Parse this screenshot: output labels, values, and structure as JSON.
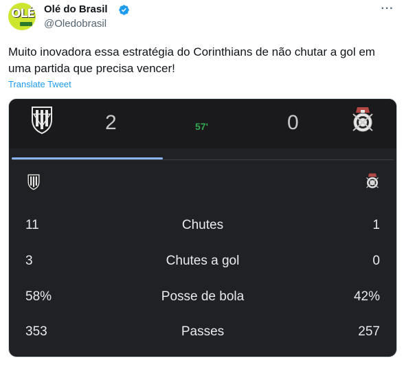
{
  "tweet": {
    "display_name": "Olé do Brasil",
    "handle": "@Oledobrasil",
    "avatar_text": "OLÉ",
    "text": "Muito inovadora essa estratégia do Corinthians de não chutar a gol em uma partida que precisa vencer!",
    "translate_label": "Translate Tweet",
    "more_icon": "ellipsis-icon",
    "verified_icon": "verified-badge-icon",
    "verified_color": "#1d9bf0"
  },
  "match": {
    "home_score": "2",
    "away_score": "0",
    "minute": "57'",
    "minute_color": "#34a853",
    "home_crest_icon": "independiente-del-valle-crest-icon",
    "away_crest_icon": "corinthians-crest-icon",
    "tab_indicator_color": "#8ab4f8"
  },
  "stats": [
    {
      "home": "11",
      "label": "Chutes",
      "away": "1"
    },
    {
      "home": "3",
      "label": "Chutes a gol",
      "away": "0"
    },
    {
      "home": "58%",
      "label": "Posse de bola",
      "away": "42%"
    },
    {
      "home": "353",
      "label": "Passes",
      "away": "257"
    }
  ]
}
